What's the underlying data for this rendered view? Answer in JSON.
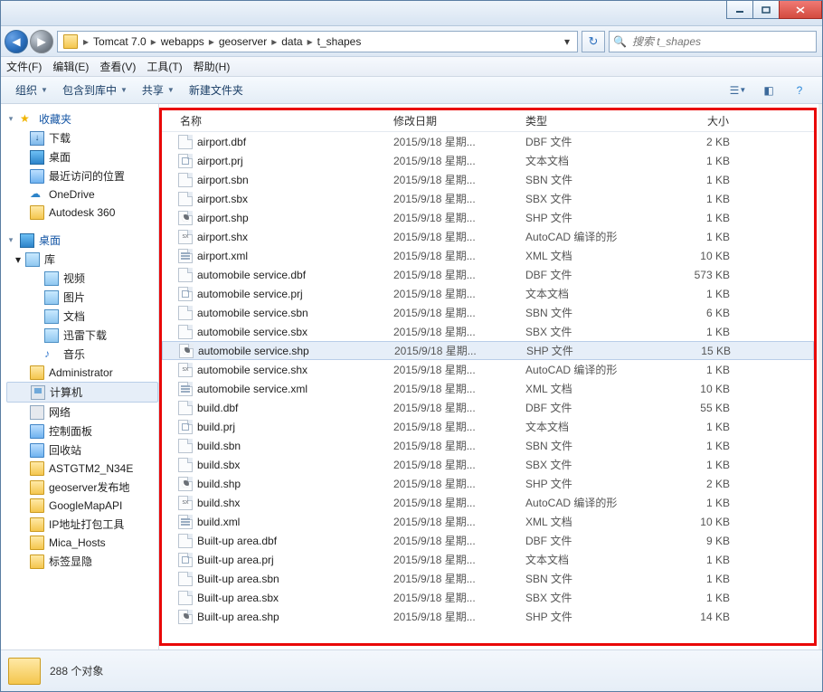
{
  "titlebar": {},
  "address": {
    "crumbs": [
      "Tomcat 7.0",
      "webapps",
      "geoserver",
      "data",
      "t_shapes"
    ],
    "search_placeholder": "搜索 t_shapes"
  },
  "menubar": {
    "file": "文件(F)",
    "edit": "编辑(E)",
    "view": "查看(V)",
    "tools": "工具(T)",
    "help": "帮助(H)"
  },
  "toolbar": {
    "organize": "组织",
    "include": "包含到库中",
    "share": "共享",
    "newfolder": "新建文件夹"
  },
  "sidebar": {
    "favorites": "收藏夹",
    "downloads": "下载",
    "desktop": "桌面",
    "recent": "最近访问的位置",
    "onedrive": "OneDrive",
    "autodesk": "Autodesk 360",
    "desktop_group": "桌面",
    "libraries": "库",
    "videos": "视频",
    "pictures": "图片",
    "documents": "文档",
    "xunlei": "迅雷下载",
    "music": "音乐",
    "admin": "Administrator",
    "computer": "计算机",
    "network": "网络",
    "controlpanel": "控制面板",
    "recycle": "回收站",
    "f1": "ASTGTM2_N34E",
    "f2": "geoserver发布地",
    "f3": "GoogleMapAPI",
    "f4": "IP地址打包工具",
    "f5": "Mica_Hosts",
    "f6": "标签显隐"
  },
  "columns": {
    "name": "名称",
    "date": "修改日期",
    "type": "类型",
    "size": "大小"
  },
  "common_date": "2015/9/18 星期...",
  "types": {
    "dbf": "DBF 文件",
    "txt": "文本文档",
    "sbn": "SBN 文件",
    "sbx": "SBX 文件",
    "shp": "SHP 文件",
    "shx": "AutoCAD 编译的形",
    "xml": "XML 文档"
  },
  "files": [
    {
      "n": "airport.dbf",
      "t": "dbf",
      "s": "2 KB",
      "i": "plain"
    },
    {
      "n": "airport.prj",
      "t": "txt",
      "s": "1 KB",
      "i": "prj"
    },
    {
      "n": "airport.sbn",
      "t": "sbn",
      "s": "1 KB",
      "i": "plain"
    },
    {
      "n": "airport.sbx",
      "t": "sbx",
      "s": "1 KB",
      "i": "plain"
    },
    {
      "n": "airport.shp",
      "t": "shp",
      "s": "1 KB",
      "i": "shp"
    },
    {
      "n": "airport.shx",
      "t": "shx",
      "s": "1 KB",
      "i": "shx"
    },
    {
      "n": "airport.xml",
      "t": "xml",
      "s": "10 KB",
      "i": "xml"
    },
    {
      "n": "automobile service.dbf",
      "t": "dbf",
      "s": "573 KB",
      "i": "plain"
    },
    {
      "n": "automobile service.prj",
      "t": "txt",
      "s": "1 KB",
      "i": "prj"
    },
    {
      "n": "automobile service.sbn",
      "t": "sbn",
      "s": "6 KB",
      "i": "plain"
    },
    {
      "n": "automobile service.sbx",
      "t": "sbx",
      "s": "1 KB",
      "i": "plain"
    },
    {
      "n": "automobile service.shp",
      "t": "shp",
      "s": "15 KB",
      "i": "shp",
      "sel": true
    },
    {
      "n": "automobile service.shx",
      "t": "shx",
      "s": "1 KB",
      "i": "shx"
    },
    {
      "n": "automobile service.xml",
      "t": "xml",
      "s": "10 KB",
      "i": "xml"
    },
    {
      "n": "build.dbf",
      "t": "dbf",
      "s": "55 KB",
      "i": "plain"
    },
    {
      "n": "build.prj",
      "t": "txt",
      "s": "1 KB",
      "i": "prj"
    },
    {
      "n": "build.sbn",
      "t": "sbn",
      "s": "1 KB",
      "i": "plain"
    },
    {
      "n": "build.sbx",
      "t": "sbx",
      "s": "1 KB",
      "i": "plain"
    },
    {
      "n": "build.shp",
      "t": "shp",
      "s": "2 KB",
      "i": "shp"
    },
    {
      "n": "build.shx",
      "t": "shx",
      "s": "1 KB",
      "i": "shx"
    },
    {
      "n": "build.xml",
      "t": "xml",
      "s": "10 KB",
      "i": "xml"
    },
    {
      "n": "Built-up area.dbf",
      "t": "dbf",
      "s": "9 KB",
      "i": "plain"
    },
    {
      "n": "Built-up area.prj",
      "t": "txt",
      "s": "1 KB",
      "i": "prj"
    },
    {
      "n": "Built-up area.sbn",
      "t": "sbn",
      "s": "1 KB",
      "i": "plain"
    },
    {
      "n": "Built-up area.sbx",
      "t": "sbx",
      "s": "1 KB",
      "i": "plain"
    },
    {
      "n": "Built-up area.shp",
      "t": "shp",
      "s": "14 KB",
      "i": "shp"
    }
  ],
  "status": {
    "count": "288 个对象"
  }
}
